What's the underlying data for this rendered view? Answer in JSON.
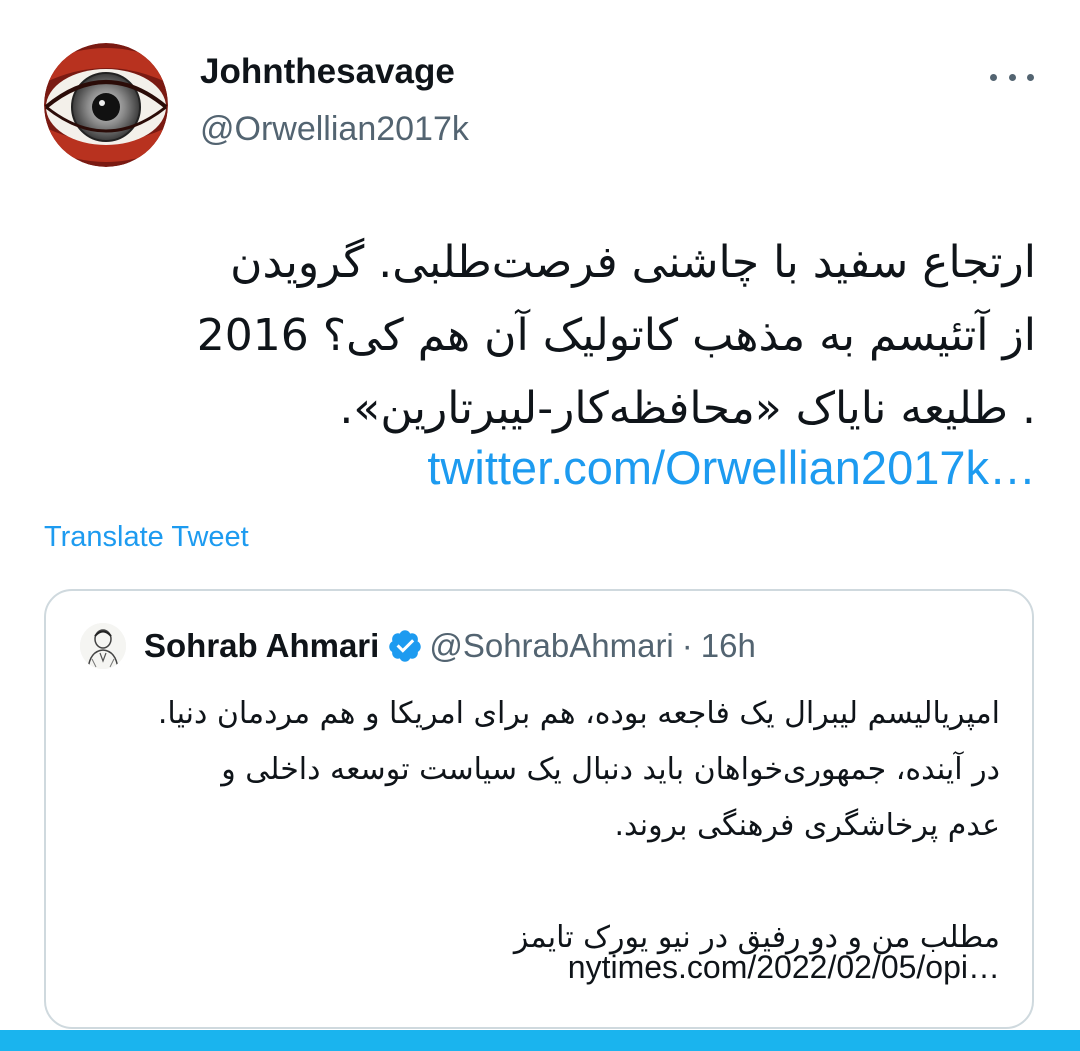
{
  "tweet": {
    "display_name": "Johnthesavage",
    "handle": "@Orwellian2017k",
    "body_lines": [
      "ارتجاع سفید با چاشنی فرصت‌طلبی. گرویدن",
      "از آتئیسم به مذهب کاتولیک آن هم کی؟ 2016",
      ". طلیعه نایاک «محافظه‌کار-لیبرتارین»."
    ],
    "link_text": "twitter.com/Orwellian2017k…",
    "translate_label": "Translate Tweet"
  },
  "quoted_tweet": {
    "display_name": "Sohrab Ahmari",
    "handle": "@SohrabAhmari",
    "separator": "·",
    "time": "16h",
    "body_lines": [
      "امپریالیسم لیبرال یک فاجعه بوده، هم برای امریکا و هم مردمان دنیا.",
      "در آینده، جمهوری‌خواهان باید دنبال یک سیاست توسعه داخلی و",
      "عدم پرخاشگری فرهنگی بروند.",
      "مطلب من و دو رفیق در نیو یورک تایمز"
    ],
    "link_text": "nytimes.com/2022/02/05/opi…"
  },
  "colors": {
    "accent": "#1d9bf0",
    "secondary_text": "#536471",
    "border": "#cfd9de",
    "bottom_bar": "#1ab4ee"
  },
  "icons": {
    "more": "more-horizontal-icon",
    "verified": "verified-badge-icon"
  }
}
